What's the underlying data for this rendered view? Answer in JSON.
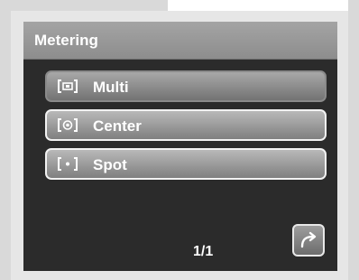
{
  "menu": {
    "title": "Metering",
    "options": [
      {
        "label": "Multi",
        "icon": "multi-metering-icon",
        "selected": true
      },
      {
        "label": "Center",
        "icon": "center-metering-icon",
        "selected": false
      },
      {
        "label": "Spot",
        "icon": "spot-metering-icon",
        "selected": false
      }
    ]
  },
  "pagination": {
    "text": "1/1"
  },
  "next_button": {
    "icon": "next-page-arrow-icon"
  },
  "colors": {
    "panel": "#2b2b2b",
    "title_bar": "#9a9a9a",
    "text": "#ffffff"
  }
}
